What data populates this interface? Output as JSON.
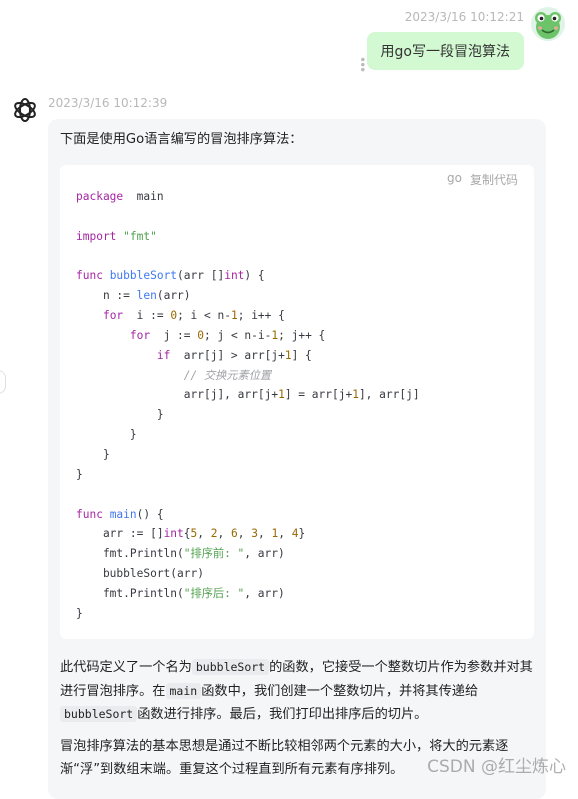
{
  "user": {
    "timestamp": "2023/3/16 10:12:21",
    "message": "用go写一段冒泡算法"
  },
  "bot": {
    "timestamp": "2023/3/16 10:12:39",
    "intro": "下面是使用Go语言编写的冒泡排序算法：",
    "code": {
      "language": "go",
      "copy_label": "复制代码",
      "lines": [
        [
          [
            "kw",
            "package"
          ],
          [
            "",
            "  main"
          ]
        ],
        [],
        [
          [
            "kw",
            "import"
          ],
          [
            "",
            ""
          ],
          [
            "str",
            " \"fmt\""
          ]
        ],
        [],
        [
          [
            "kw",
            "func"
          ],
          [
            "",
            ""
          ],
          [
            "fn",
            " bubbleSort"
          ],
          [
            "",
            "(arr []"
          ],
          [
            "kw",
            "int"
          ],
          [
            "",
            ") {"
          ]
        ],
        [
          [
            "",
            "    n := "
          ],
          [
            "fn",
            "len"
          ],
          [
            "",
            "(arr)"
          ]
        ],
        [
          [
            "",
            "    "
          ],
          [
            "kw",
            "for"
          ],
          [
            "",
            "  i := "
          ],
          [
            "num",
            "0"
          ],
          [
            "",
            "; i < n-"
          ],
          [
            "num",
            "1"
          ],
          [
            "",
            "; i++ {"
          ]
        ],
        [
          [
            "",
            "        "
          ],
          [
            "kw",
            "for"
          ],
          [
            "",
            "  j := "
          ],
          [
            "num",
            "0"
          ],
          [
            "",
            "; j < n-i-"
          ],
          [
            "num",
            "1"
          ],
          [
            "",
            "; j++ {"
          ]
        ],
        [
          [
            "",
            "            "
          ],
          [
            "kw",
            "if"
          ],
          [
            "",
            "  arr[j] > arr[j+"
          ],
          [
            "num",
            "1"
          ],
          [
            "",
            "] {"
          ]
        ],
        [
          [
            "",
            "                "
          ],
          [
            "cmt",
            "// 交换元素位置"
          ]
        ],
        [
          [
            "",
            "                arr[j], arr[j+"
          ],
          [
            "num",
            "1"
          ],
          [
            "",
            "] = arr[j+"
          ],
          [
            "num",
            "1"
          ],
          [
            "",
            "], arr[j]"
          ]
        ],
        [
          [
            "",
            "            }"
          ]
        ],
        [
          [
            "",
            "        }"
          ]
        ],
        [
          [
            "",
            "    }"
          ]
        ],
        [
          [
            "",
            "}"
          ]
        ],
        [],
        [
          [
            "kw",
            "func"
          ],
          [
            "fn",
            " main"
          ],
          [
            "",
            "() {"
          ]
        ],
        [
          [
            "",
            "    arr := []"
          ],
          [
            "kw",
            "int"
          ],
          [
            "",
            "{"
          ],
          [
            "num",
            "5"
          ],
          [
            "",
            ", "
          ],
          [
            "num",
            "2"
          ],
          [
            "",
            ", "
          ],
          [
            "num",
            "6"
          ],
          [
            "",
            ", "
          ],
          [
            "num",
            "3"
          ],
          [
            "",
            ", "
          ],
          [
            "num",
            "1"
          ],
          [
            "",
            ", "
          ],
          [
            "num",
            "4"
          ],
          [
            "",
            "}"
          ]
        ],
        [
          [
            "",
            "    fmt.Println("
          ],
          [
            "str",
            "\"排序前: \""
          ],
          [
            "",
            ", arr)"
          ]
        ],
        [
          [
            "",
            "    bubbleSort(arr)"
          ]
        ],
        [
          [
            "",
            "    fmt.Println("
          ],
          [
            "str",
            "\"排序后: \""
          ],
          [
            "",
            ", arr)"
          ]
        ],
        [
          [
            "",
            "}"
          ]
        ]
      ]
    },
    "explanation": {
      "p1": "此代码定义了一个名为",
      "c1": "bubbleSort",
      "p2": "的函数，它接受一个整数切片作为参数并对其进行冒泡排序。在",
      "c2": "main",
      "p3": "函数中，我们创建一个整数切片，并将其传递给",
      "c3": "bubbleSort",
      "p4": "函数进行排序。最后，我们打印出排序后的切片。"
    },
    "summary": "冒泡排序算法的基本思想是通过不断比较相邻两个元素的大小，将大的元素逐渐“浮”到数组末端。重复这个过程直到所有元素有序排列。"
  },
  "watermark": "CSDN @红尘炼心",
  "icons": {
    "user_avatar": "frog-avatar-icon",
    "bot_avatar": "openai-logo-icon",
    "more": "more-vertical-icon"
  },
  "colors": {
    "user_bubble": "#d2f9d1",
    "bot_bubble": "#f4f6f8",
    "keyword": "#a626a4",
    "function": "#4078f2",
    "string": "#50a14f",
    "number": "#986801"
  }
}
